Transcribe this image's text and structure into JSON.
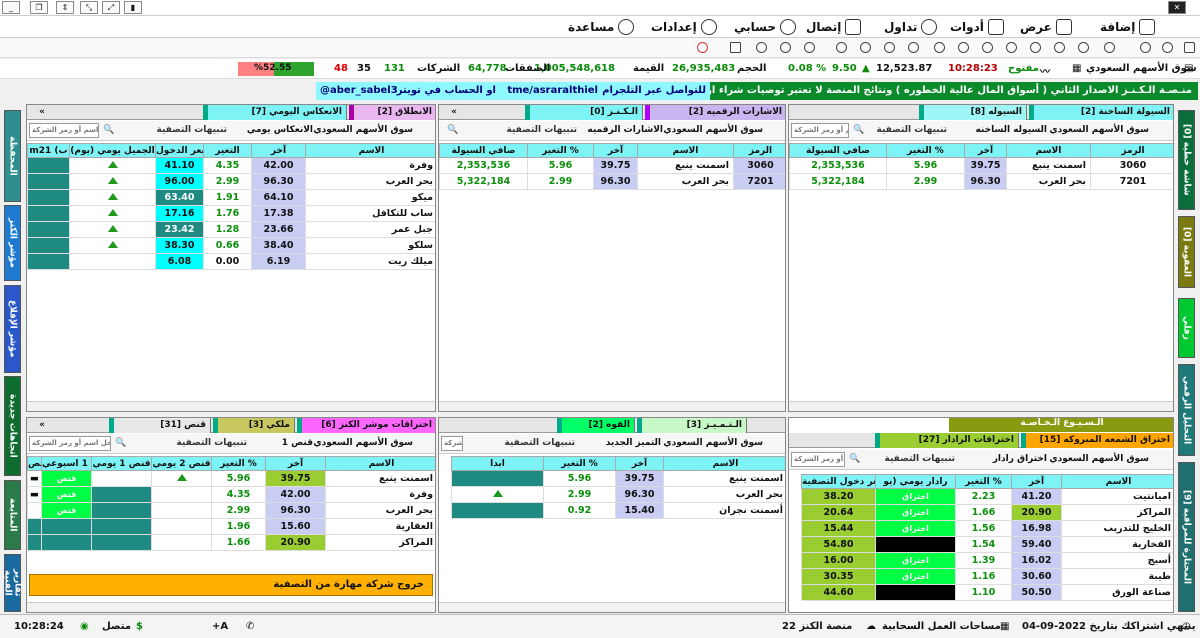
{
  "menu": {
    "items": [
      {
        "label": "إضافة",
        "icon": "add-icon"
      },
      {
        "label": "عرض",
        "icon": "view-icon"
      },
      {
        "label": "أدوات",
        "icon": "tools-icon"
      },
      {
        "label": "تداول",
        "icon": "trade-cart-icon"
      },
      {
        "label": "إتصال",
        "icon": "connect-icon"
      },
      {
        "label": "حسابي",
        "icon": "account-icon"
      },
      {
        "label": "إعدادات",
        "icon": "settings-gear-icon"
      },
      {
        "label": "مساعدة",
        "icon": "help-icon"
      }
    ]
  },
  "market": {
    "name": "سوق الأسهم السعودي",
    "time": "10:28:23",
    "state": "مفتوح",
    "index": "12,523.87",
    "change": "9.50",
    "change_pct": "0.08 %",
    "volume_label": "الحجم",
    "volume": "26,935,483",
    "value_label": "القيمة",
    "value": "1,005,548,618",
    "deals_label": "الصفقات",
    "deals": "64,778",
    "companies_label": "الشركات",
    "up": "131",
    "flat": "35",
    "down": "48",
    "ratio": "%52.55",
    "ratio_value": 0.5255
  },
  "banner": {
    "text": "منـصـة الـكـنـز الاصدار الثاني ( أسواق المال عالية الخطوره ) ونتائج المنصة لا تعتبر توصيات شراء او بيع",
    "telegram_label": "للتواصل عبر التلجرام",
    "telegram": "tme/asraralthiel",
    "twitter_label": "او الحساب في تويتر",
    "twitter": "@aber_sabel3"
  },
  "left_tabs": [
    "المحفظة",
    "مؤشر الكنز",
    "مؤشر الإقلاع",
    "اتجاهات جديدة",
    "المتابعة",
    "تقارير الفنية"
  ],
  "right_tabs": [
    "شاشة خطية [0]",
    "العقوبة [0]",
    "زفلي",
    "التحليل الرقمي",
    "المختارة للمراقبة [9]"
  ],
  "common": {
    "market_select": "سوق الأسهم السعودي",
    "search_placeholder": "ادخل اسم أو رمز الشركة",
    "alerts": "تنبيهات التصفية"
  },
  "panel_liquidity": {
    "tabs": [
      "السيولة الساخنة [2]",
      "السيوله [8]"
    ],
    "filter": "السيوله الساخنه",
    "headers": [
      "الرمز",
      "الاسم",
      "آخر",
      "التغير %",
      "صافي السيولة"
    ],
    "rows": [
      {
        "code": "3060",
        "name": "اسمنت ينبع",
        "last": "39.75",
        "chg": "5.96",
        "net": "2,353,536"
      },
      {
        "code": "7201",
        "name": "بحر العرب",
        "last": "96.30",
        "chg": "2.99",
        "net": "5,322,184"
      }
    ]
  },
  "panel_signals": {
    "tabs": [
      "الاشارات الرقميه [2]",
      "الـكـنـز [0]"
    ],
    "filter": "الاشارات الرقميه",
    "headers": [
      "الرمز",
      "الاسم",
      "آخر",
      "التغير %",
      "صافي السيولة"
    ],
    "rows": [
      {
        "code": "3060",
        "name": "اسمنت ينبع",
        "last": "39.75",
        "chg": "5.96",
        "net": "2,353,536"
      },
      {
        "code": "7201",
        "name": "بحر العرب",
        "last": "96.30",
        "chg": "2.99",
        "net": "5,322,184"
      }
    ]
  },
  "panel_reverse": {
    "tabs": [
      "الانطلاق [2]",
      "الانعكاس اليومي [7]"
    ],
    "filter": "الانعكاس يومي",
    "headers": [
      "الاسم",
      "آخر",
      "التغير",
      "سعر الدخول",
      "الجميل يومي (يوم)",
      "m21 (ب"
    ],
    "rows": [
      {
        "name": "وفرة",
        "last": "42.00",
        "chg": "4.35",
        "entry": "41.10"
      },
      {
        "name": "بحر العرب",
        "last": "96.30",
        "chg": "2.99",
        "entry": "96.00"
      },
      {
        "name": "ميكو",
        "last": "64.10",
        "chg": "1.91",
        "entry": "63.40"
      },
      {
        "name": "ساب للتكافل",
        "last": "17.38",
        "chg": "1.76",
        "entry": "17.16"
      },
      {
        "name": "جبل عمر",
        "last": "23.66",
        "chg": "1.28",
        "entry": "23.42"
      },
      {
        "name": "سلكو",
        "last": "38.40",
        "chg": "0.66",
        "entry": "38.30"
      },
      {
        "name": "ميلك ريت",
        "last": "6.19",
        "chg": "0.00",
        "entry": "6.08"
      }
    ]
  },
  "panel_breakout": {
    "title": "الـسـيـوع الـخـاصـة",
    "tabs": [
      "اختراق الشمعه المبروكه [15]",
      "اختراقات الرادار [27]"
    ],
    "filter": "اختراق رادار",
    "headers": [
      "الاسم",
      "آخر",
      "التغير %",
      "رادار يومي (يو",
      "سعر دخول التصفية"
    ],
    "rows": [
      {
        "name": "اميانتيت",
        "last": "41.20",
        "chg": "2.23",
        "radar": "اختراق",
        "entry": "38.20"
      },
      {
        "name": "المراكز",
        "last": "20.90",
        "chg": "1.66",
        "radar": "اختراق",
        "entry": "20.64"
      },
      {
        "name": "الخليج للتدريب",
        "last": "16.98",
        "chg": "1.56",
        "radar": "اختراق",
        "entry": "15.44"
      },
      {
        "name": "الفخارية",
        "last": "59.40",
        "chg": "1.54",
        "radar": "",
        "entry": "54.80"
      },
      {
        "name": "أسيج",
        "last": "16.02",
        "chg": "1.39",
        "radar": "اختراق",
        "entry": "16.00"
      },
      {
        "name": "طيبة",
        "last": "30.60",
        "chg": "1.16",
        "radar": "اختراق",
        "entry": "30.35"
      },
      {
        "name": "صناعة الورق",
        "last": "50.50",
        "chg": "1.10",
        "radar": "",
        "entry": "44.60"
      }
    ]
  },
  "panel_distinct": {
    "tabs": [
      "الـتـمـيـز [3]",
      "القوه [2]"
    ],
    "filter": "التميز الجديد",
    "headers": [
      "الاسم",
      "آخر",
      "التغير %",
      "ابدا"
    ],
    "rows": [
      {
        "name": "اسمنت ينبع",
        "last": "39.75",
        "chg": "5.96"
      },
      {
        "name": "بحر العرب",
        "last": "96.30",
        "chg": "2.99"
      },
      {
        "name": "أسمنت نجران",
        "last": "15.40",
        "chg": "0.92"
      }
    ]
  },
  "panel_snipe": {
    "tabs": [
      "اختراقات موشر الكنز [6]",
      "ملكي [3]",
      "قنص [31]"
    ],
    "filter": "قنص 1",
    "headers": [
      "الاسم",
      "آخر",
      "التغير %",
      "قنص 2 يومي",
      "قنص 1 يومي",
      "قنص 1 اسبوعي",
      "قنص"
    ],
    "rows": [
      {
        "name": "اسمنت ينبع",
        "last": "39.75",
        "chg": "5.96",
        "tag": "قنص"
      },
      {
        "name": "وفرة",
        "last": "42.00",
        "chg": "4.35",
        "tag": "قنص"
      },
      {
        "name": "بحر العرب",
        "last": "96.30",
        "chg": "2.99",
        "tag": "قنص"
      },
      {
        "name": "العقارية",
        "last": "15.60",
        "chg": "1.96",
        "tag": ""
      },
      {
        "name": "المراكز",
        "last": "20.90",
        "chg": "1.66",
        "tag": ""
      }
    ],
    "exit_notice": "خروج شركة مهارة من التصفية"
  },
  "status": {
    "subscription": "ينتهي اشتراكك بتاريخ 2022-09-04",
    "cloud": "مساحات العمل السحابية",
    "platform": "منصة الكنز 22",
    "connected": "متصل",
    "clock": "10:28:24"
  },
  "colors": {
    "cyan": "#7df3f6",
    "teal": "#1e8a82",
    "lime": "#00ff44",
    "last_col": "#c9cdf4",
    "positive": "#0b8f0b"
  }
}
